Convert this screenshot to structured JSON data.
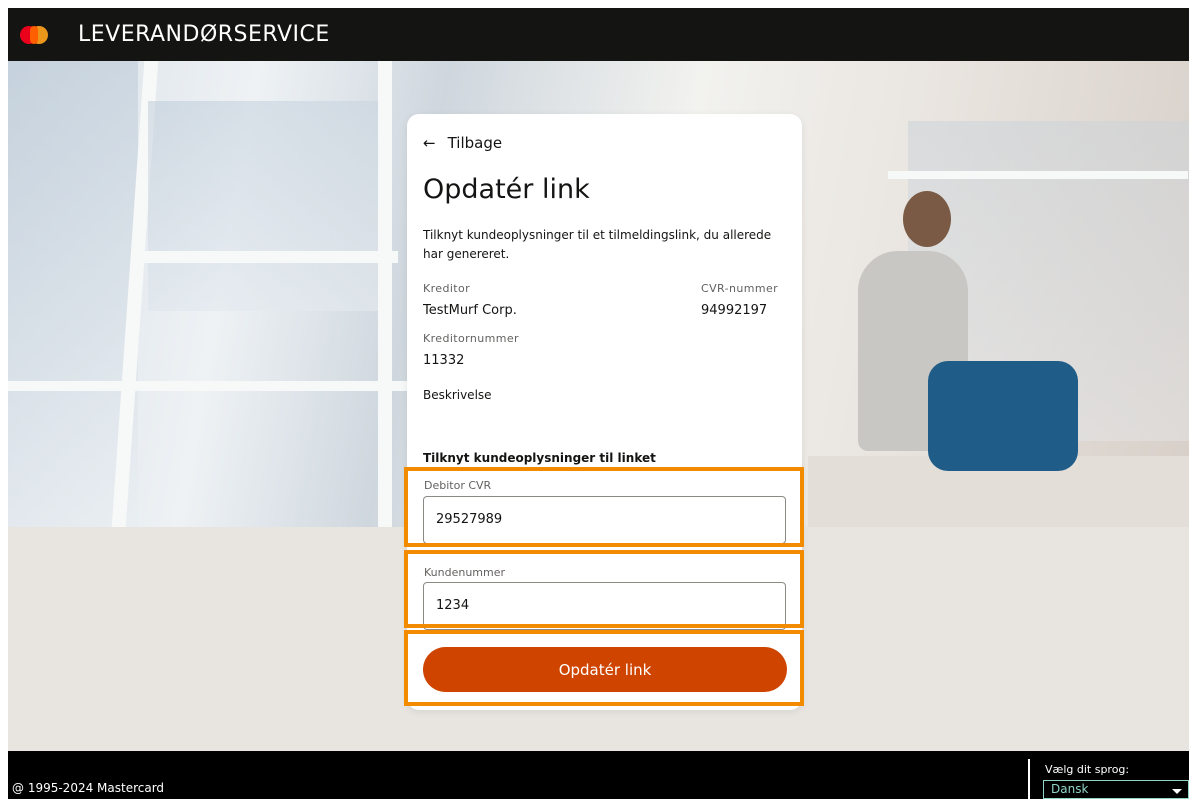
{
  "header": {
    "brand": "LEVERANDØRSERVICE"
  },
  "card": {
    "back_label": "Tilbage",
    "title": "Opdatér link",
    "description": "Tilknyt kundeoplysninger til et tilmeldingslink, du allerede har genereret.",
    "kreditor_label": "Kreditor",
    "kreditor_value": "TestMurf Corp.",
    "cvr_label": "CVR-nummer",
    "cvr_value": "94992197",
    "kreditornummer_label": "Kreditornummer",
    "kreditornummer_value": "11332",
    "beskrivelse_label": "Beskrivelse",
    "section_title": "Tilknyt kundeoplysninger til linket",
    "debitor_cvr_label": "Debitor CVR",
    "debitor_cvr_value": "29527989",
    "kundenummer_label": "Kundenummer",
    "kundenummer_value": "1234",
    "submit_label": "Opdatér link"
  },
  "footer": {
    "copyright": "@ 1995-2024 Mastercard",
    "language_label": "Vælg dit sprog:",
    "language_value": "Dansk"
  },
  "colors": {
    "accent": "#cf4500",
    "highlight": "#f38b00",
    "header": "#141413"
  }
}
